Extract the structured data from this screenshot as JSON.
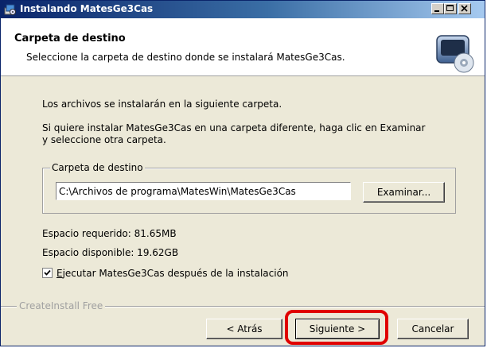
{
  "window": {
    "title": "Instalando MatesGe3Cas"
  },
  "header": {
    "title": "Carpeta de destino",
    "subtitle": "Seleccione la carpeta de destino donde se instalará MatesGe3Cas."
  },
  "body": {
    "intro": "Los archivos se instalarán en la siguiente carpeta.",
    "instructions_line1": "Si quiere instalar MatesGe3Cas en una carpeta diferente, haga clic en Examinar",
    "instructions_line2": "y seleccione otra carpeta."
  },
  "destination": {
    "group_label": "Carpeta de destino",
    "path": "C:\\Archivos de programa\\MatesWin\\MatesGe3Cas",
    "browse_label": "Examinar..."
  },
  "space": {
    "required": "Espacio requerido: 81.65MB",
    "available": "Espacio disponible: 19.62GB"
  },
  "options": {
    "run_after_checked": true,
    "run_after_prefix": "E",
    "run_after_rest": "jecutar MatesGe3Cas después de la instalación"
  },
  "footer": {
    "brand": "CreateInstall Free",
    "back_label": "< Atrás",
    "next_label": "Siguiente >",
    "cancel_label": "Cancelar"
  },
  "colors": {
    "highlight": "#e00000",
    "titlebar_start": "#0a246a",
    "dialog_bg": "#ece9d8"
  },
  "icons": {
    "title": "installer-icon",
    "header": "cd-drive-icon"
  }
}
